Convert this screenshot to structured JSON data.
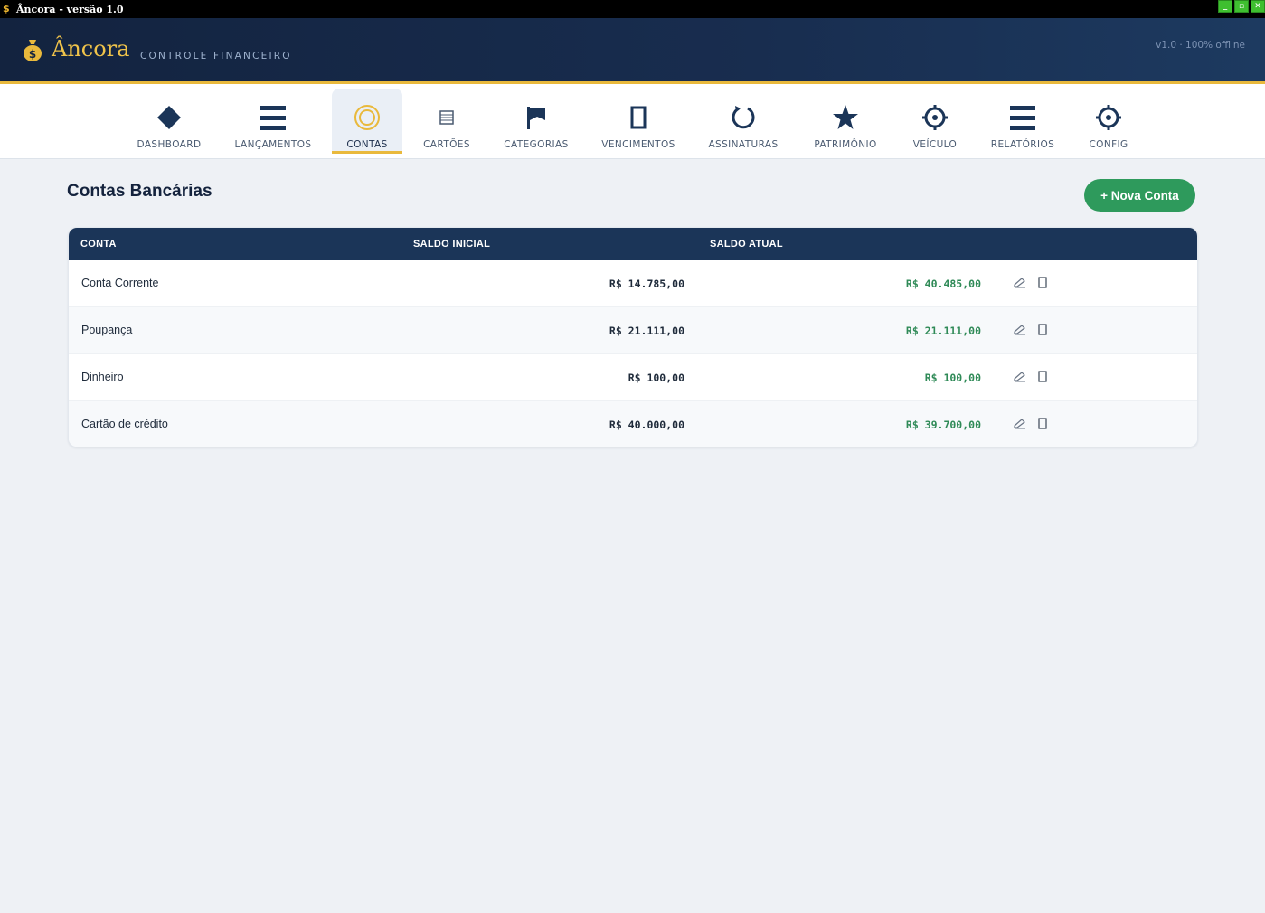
{
  "window": {
    "title": "Âncora - versão 1.0",
    "buttons": [
      "_",
      "▫",
      "✕"
    ]
  },
  "header": {
    "brand": "Âncora",
    "subtitle": "CONTROLE FINANCEIRO",
    "version": "v1.0 · 100% offline"
  },
  "nav": {
    "items": [
      {
        "label": "DASHBOARD",
        "icon": "diamond-icon"
      },
      {
        "label": "LANÇAMENTOS",
        "icon": "list-icon"
      },
      {
        "label": "CONTAS",
        "icon": "target-icon",
        "active": true
      },
      {
        "label": "CARTÕES",
        "icon": "card-icon"
      },
      {
        "label": "CATEGORIAS",
        "icon": "flag-icon"
      },
      {
        "label": "VENCIMENTOS",
        "icon": "rectangle-icon"
      },
      {
        "label": "ASSINATURAS",
        "icon": "refresh-icon"
      },
      {
        "label": "PATRIMÔNIO",
        "icon": "star-icon"
      },
      {
        "label": "VEÍCULO",
        "icon": "wheel-icon"
      },
      {
        "label": "RELATÓRIOS",
        "icon": "list-icon"
      },
      {
        "label": "CONFIG",
        "icon": "gear-icon"
      }
    ]
  },
  "main": {
    "title": "Contas Bancárias",
    "new_button": "+ Nova Conta",
    "table": {
      "columns": [
        "CONTA",
        "SALDO INICIAL",
        "SALDO ATUAL"
      ],
      "rows": [
        {
          "name": "Conta Corrente",
          "initial": "R$ 14.785,00",
          "current": "R$ 40.485,00"
        },
        {
          "name": "Poupança",
          "initial": "R$ 21.111,00",
          "current": "R$ 21.111,00"
        },
        {
          "name": "Dinheiro",
          "initial": "R$ 100,00",
          "current": "R$ 100,00"
        },
        {
          "name": "Cartão de crédito",
          "initial": "R$ 40.000,00",
          "current": "R$ 39.700,00"
        }
      ]
    }
  },
  "colors": {
    "header_bg": "#13233f",
    "accent_gold": "#e9b93c",
    "success_green": "#2e9a5c",
    "table_header": "#1b3558"
  }
}
